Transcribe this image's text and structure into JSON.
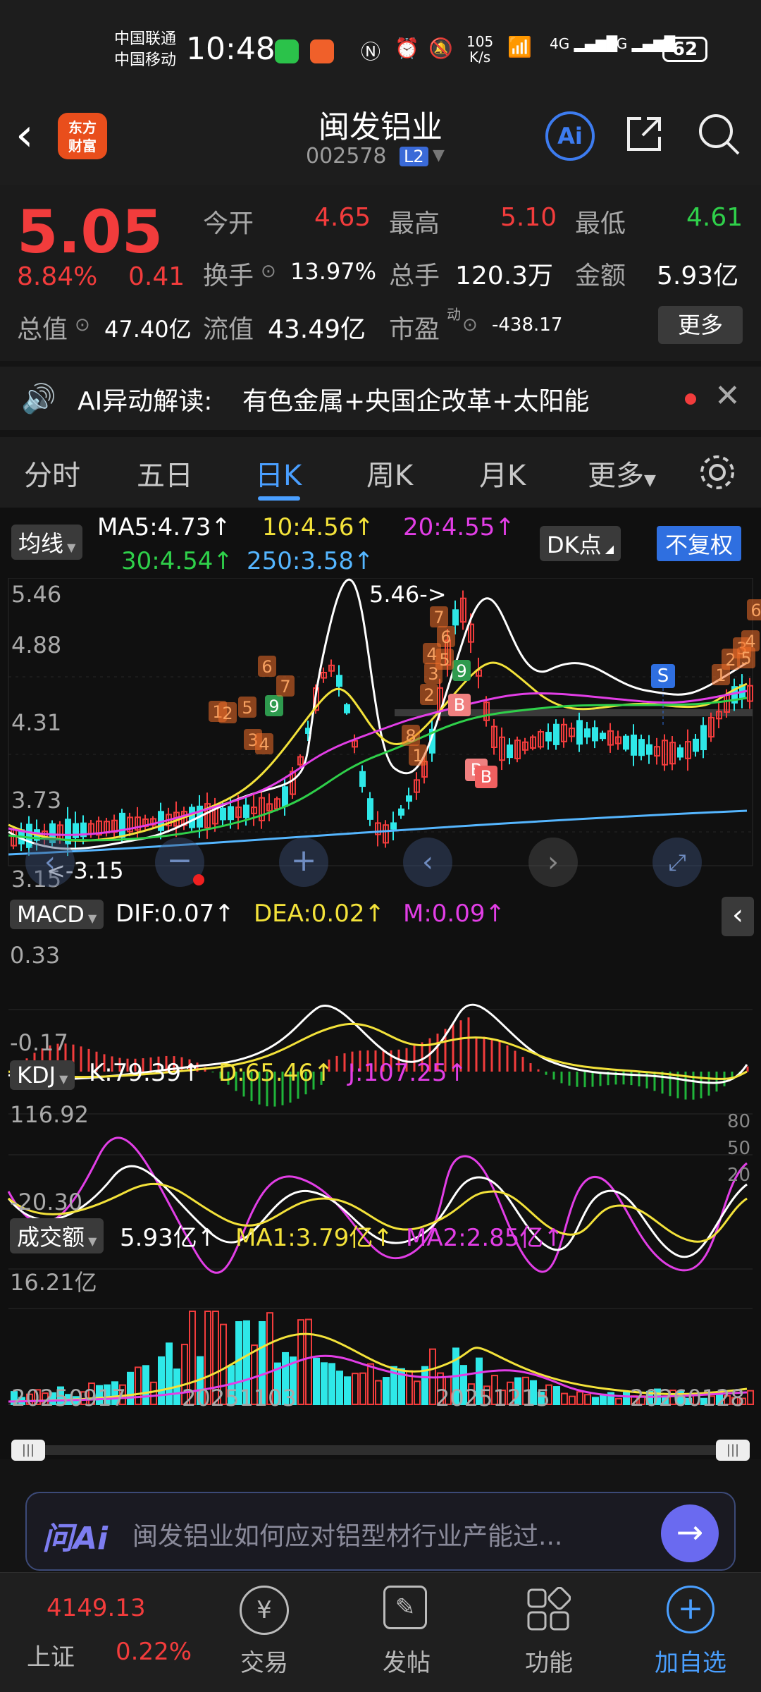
{
  "status_bar": {
    "carrier1": "中国联通",
    "carrier2": "中国移动",
    "time": "10:48",
    "net_speed_value": "105",
    "net_speed_unit": "K/s",
    "signal1": "4G",
    "signal2": "4G",
    "battery": "62"
  },
  "header": {
    "logo_line1": "东方",
    "logo_line2": "财富",
    "stock_name": "闽发铝业",
    "stock_code": "002578",
    "level_badge": "L2",
    "ai_label": "Ai"
  },
  "quote": {
    "price": "5.05",
    "change_pct": "8.84%",
    "change_amt": "0.41",
    "open_label": "今开",
    "open": "4.65",
    "high_label": "最高",
    "high": "5.10",
    "low_label": "最低",
    "low": "4.61",
    "turnover_label": "换手",
    "turnover": "13.97%",
    "volume_label": "总手",
    "volume": "120.3万",
    "amount_label": "金额",
    "amount": "5.93亿",
    "mktcap_label": "总值",
    "mktcap": "47.40亿",
    "float_label": "流值",
    "float_cap": "43.49亿",
    "pe_label": "市盈",
    "pe_sup": "动",
    "pe": "-438.17",
    "more_label": "更多"
  },
  "ai_banner": {
    "prefix": "AI异动解读:",
    "text": "有色金属+央国企改革+太阳能"
  },
  "tabs": [
    {
      "label": "分时"
    },
    {
      "label": "五日"
    },
    {
      "label": "日K"
    },
    {
      "label": "周K"
    },
    {
      "label": "月K"
    },
    {
      "label": "更多"
    }
  ],
  "ma_line": {
    "selector": "均线",
    "ma5": "MA5:4.73↑",
    "ma10": "10:4.56↑",
    "ma20": "20:4.55↑",
    "ma30": "30:4.54↑",
    "ma250": "250:3.58↑",
    "dk_label": "DK点",
    "adjust_label": "不复权"
  },
  "kline": {
    "y_ticks": [
      "5.46",
      "4.88",
      "4.31",
      "3.73",
      "3.15"
    ],
    "high_marker": "5.46->",
    "low_marker": "<-3.15",
    "signal_labels": [
      "S",
      "B",
      "B",
      "B",
      "9",
      "9"
    ],
    "count_labels": [
      "1",
      "2",
      "3",
      "4",
      "5",
      "6",
      "7",
      "8",
      "1",
      "2",
      "3",
      "4",
      "5",
      "6",
      "7",
      "1",
      "2",
      "3",
      "4",
      "5",
      "6"
    ]
  },
  "macd": {
    "selector": "MACD",
    "dif": "DIF:0.07↑",
    "dea": "DEA:0.02↑",
    "m": "M:0.09↑",
    "y_top": "0.33",
    "y_bottom": "-0.17"
  },
  "kdj": {
    "selector": "KDJ",
    "k": "K:79.39↑",
    "d": "D:65.46↑",
    "j": "J:107.25↑",
    "y_top": "116.92",
    "y_bottom": "-20.30",
    "ref80": "80",
    "ref50": "50",
    "ref20": "20"
  },
  "amount_panel": {
    "selector": "成交额",
    "value": "5.93亿↑",
    "ma1": "MA1:3.79亿↑",
    "ma2": "MA2:2.85亿↑",
    "y_top": "16.21亿"
  },
  "x_dates": [
    "20250917",
    "20251103",
    "20251215",
    "20260128"
  ],
  "ask_ai": {
    "brand": "问Ai",
    "prompt": "闽发铝业如何应对铝型材行业产能过..."
  },
  "tabbar": {
    "index_value": "4149.13",
    "index_name": "上证",
    "index_change": "0.22%",
    "items": [
      {
        "label": "交易"
      },
      {
        "label": "发帖"
      },
      {
        "label": "功能"
      },
      {
        "label": "加自选"
      }
    ]
  },
  "colors": {
    "up": "#f23c3c",
    "down": "#2fd04a",
    "ma5": "#ffffff",
    "ma10": "#f3e23a",
    "ma20": "#e23ee6",
    "ma30": "#2fd04a",
    "ma250": "#55b6ff",
    "accent": "#4a9fff"
  }
}
